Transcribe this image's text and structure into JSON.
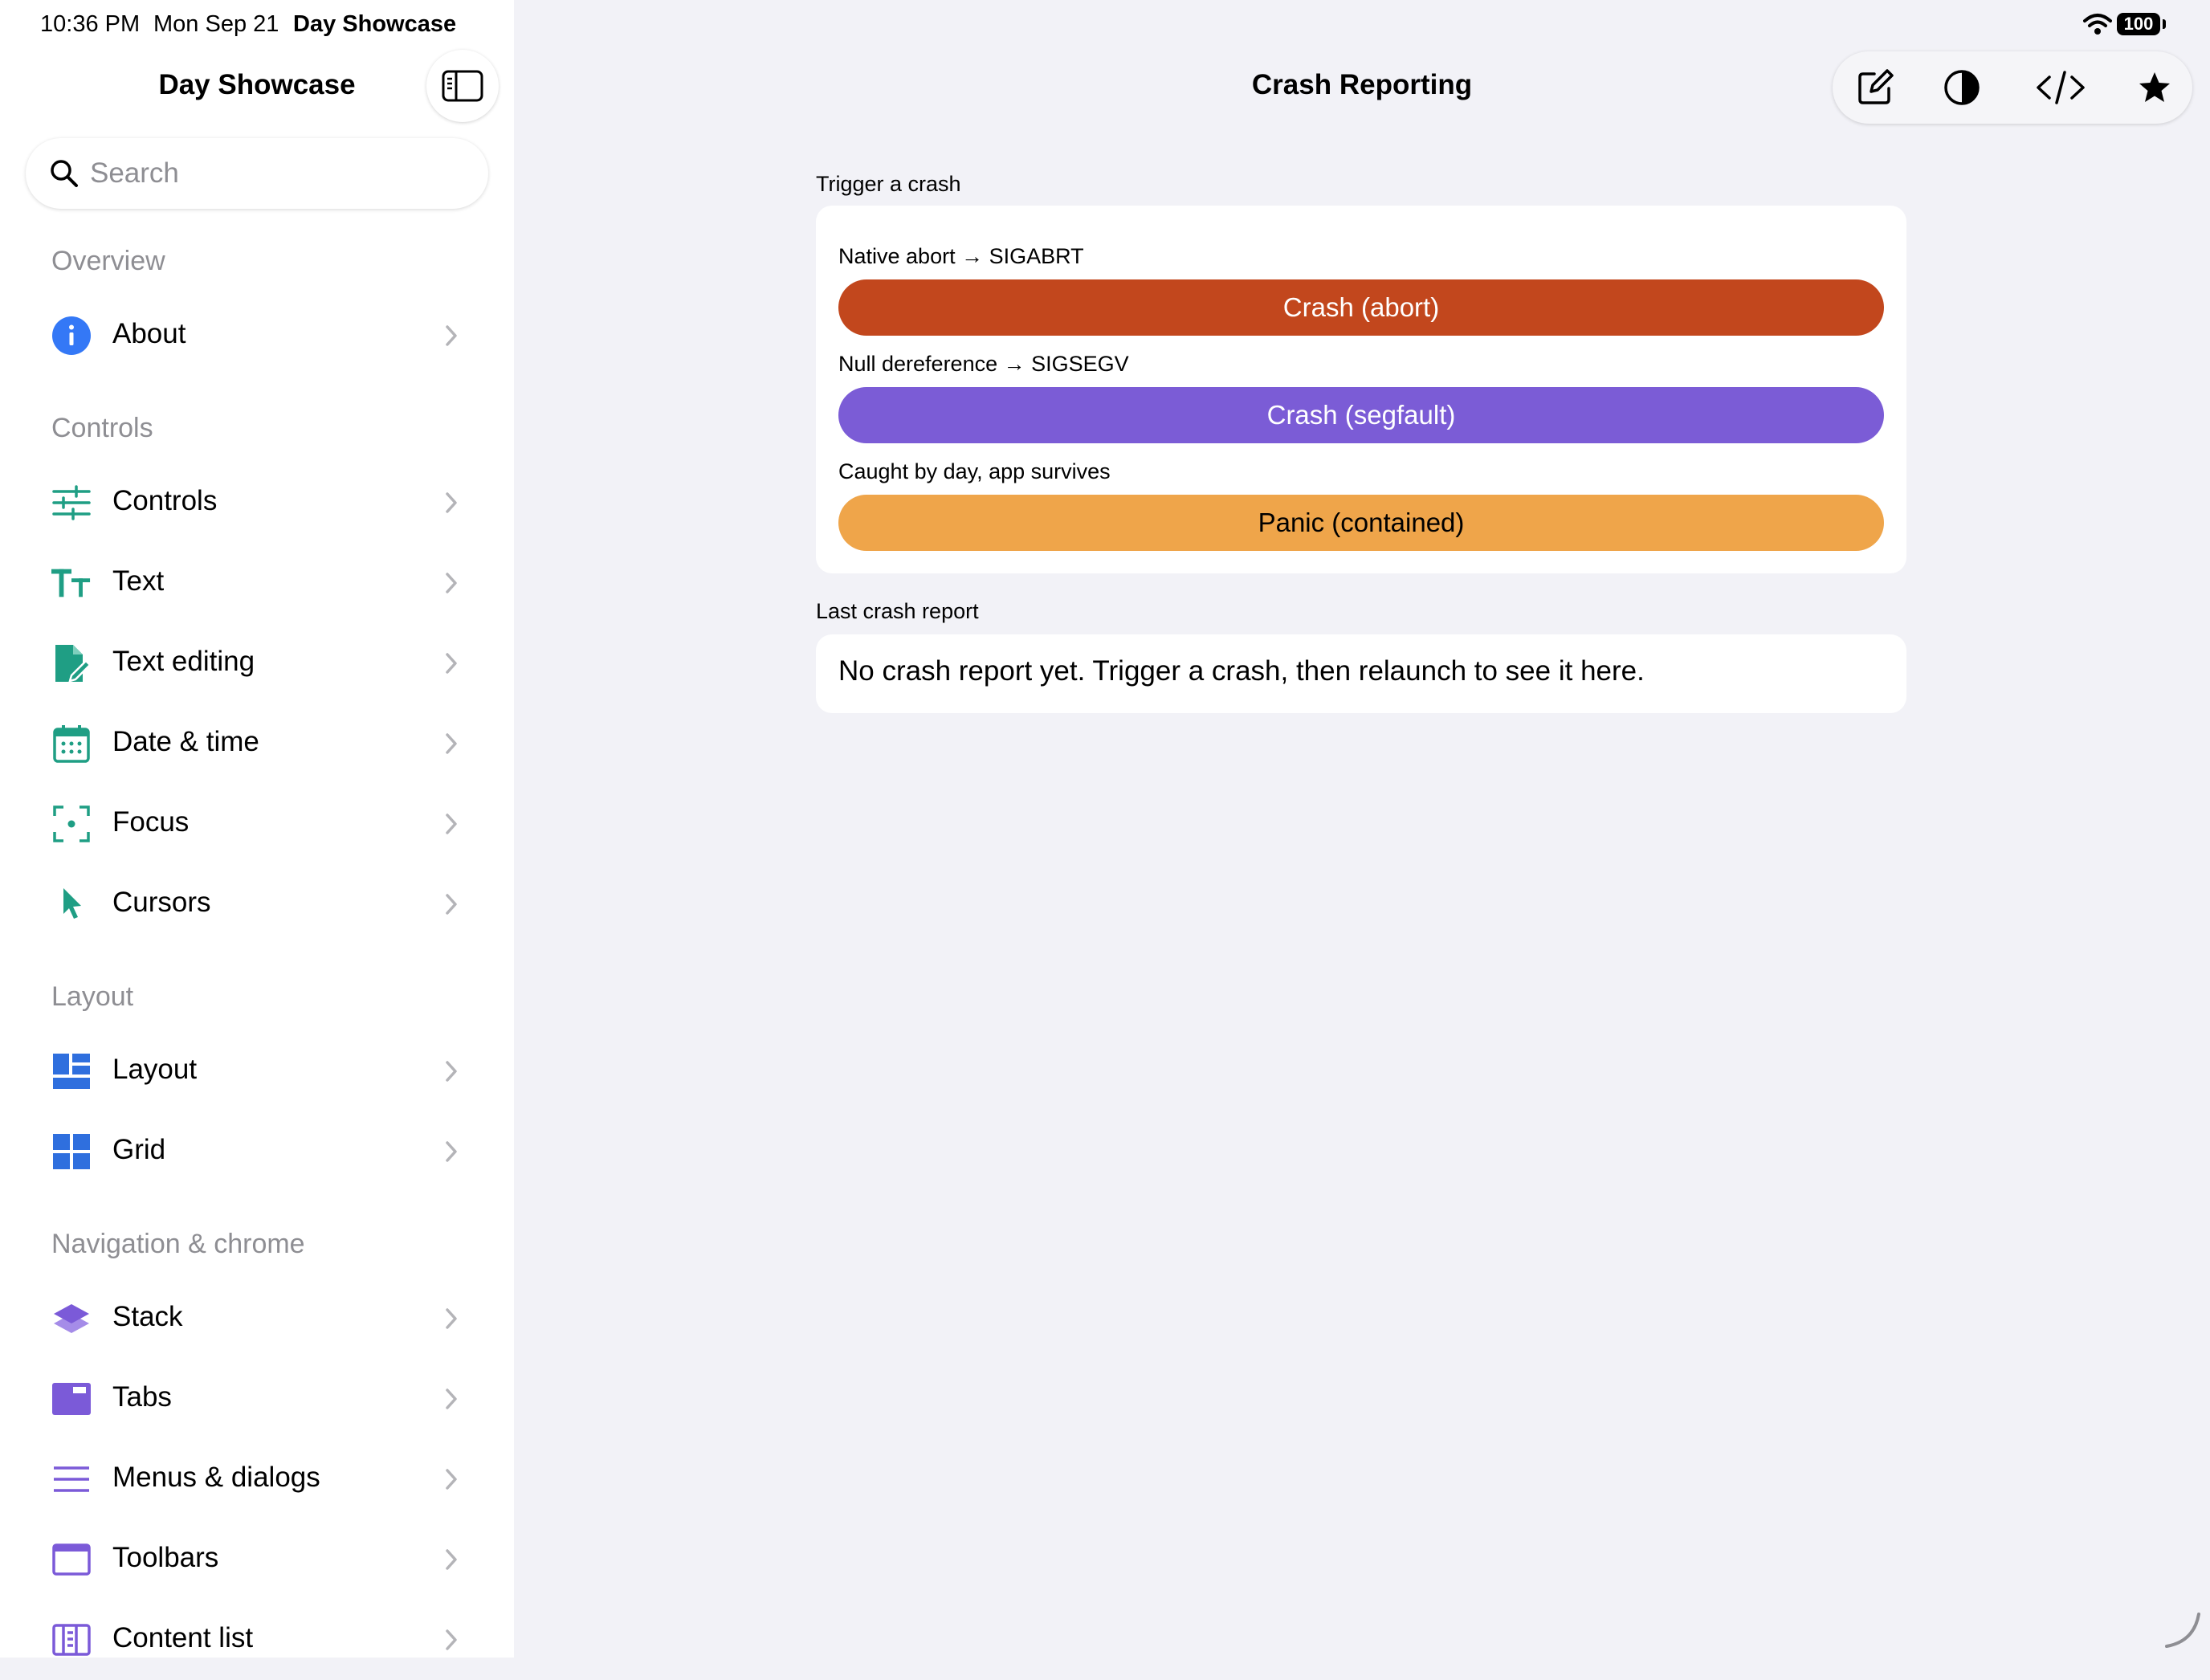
{
  "status_bar": {
    "time": "10:36 PM",
    "date": "Mon Sep 21",
    "app": "Day Showcase",
    "battery": "100"
  },
  "sidebar": {
    "title": "Day Showcase",
    "search": {
      "placeholder": "Search",
      "value": ""
    },
    "sections": [
      {
        "header": "Overview",
        "items": [
          {
            "label": "About",
            "icon": "info-icon",
            "color": "#3478f6"
          }
        ]
      },
      {
        "header": "Controls",
        "items": [
          {
            "label": "Controls",
            "icon": "sliders-icon",
            "color": "#1f9e84"
          },
          {
            "label": "Text",
            "icon": "text-size-icon",
            "color": "#1f9e84"
          },
          {
            "label": "Text editing",
            "icon": "document-edit-icon",
            "color": "#1f9e84"
          },
          {
            "label": "Date & time",
            "icon": "calendar-icon",
            "color": "#1f9e84"
          },
          {
            "label": "Focus",
            "icon": "focus-icon",
            "color": "#1f9e84"
          },
          {
            "label": "Cursors",
            "icon": "cursor-icon",
            "color": "#1f9e84"
          }
        ]
      },
      {
        "header": "Layout",
        "items": [
          {
            "label": "Layout",
            "icon": "layout-icon",
            "color": "#2f6fde"
          },
          {
            "label": "Grid",
            "icon": "grid-icon",
            "color": "#2f6fde"
          }
        ]
      },
      {
        "header": "Navigation & chrome",
        "items": [
          {
            "label": "Stack",
            "icon": "stack-icon",
            "color": "#7b5ad8"
          },
          {
            "label": "Tabs",
            "icon": "tabs-icon",
            "color": "#7b5ad8"
          },
          {
            "label": "Menus & dialogs",
            "icon": "menu-icon",
            "color": "#7b5ad8"
          },
          {
            "label": "Toolbars",
            "icon": "toolbar-icon",
            "color": "#7b5ad8"
          },
          {
            "label": "Content list",
            "icon": "content-list-icon",
            "color": "#7b5ad8"
          }
        ]
      }
    ]
  },
  "main": {
    "title": "Crash Reporting",
    "toolbar": [
      "compose-icon",
      "contrast-icon",
      "code-icon",
      "star-icon"
    ],
    "trigger_section": {
      "label": "Trigger a crash",
      "buttons": [
        {
          "caption": "Native abort → SIGABRT",
          "label": "Crash (abort)",
          "color": "#c2471d",
          "text_color": "#ffffff"
        },
        {
          "caption": "Null dereference → SIGSEGV",
          "label": "Crash (segfault)",
          "color": "#7b5cd6",
          "text_color": "#ffffff"
        },
        {
          "caption": "Caught by day, app survives",
          "label": "Panic (contained)",
          "color": "#efa54a",
          "text_color": "#000000"
        }
      ]
    },
    "report_section": {
      "label": "Last crash report",
      "text": "No crash report yet. Trigger a crash, then relaunch to see it here."
    }
  }
}
